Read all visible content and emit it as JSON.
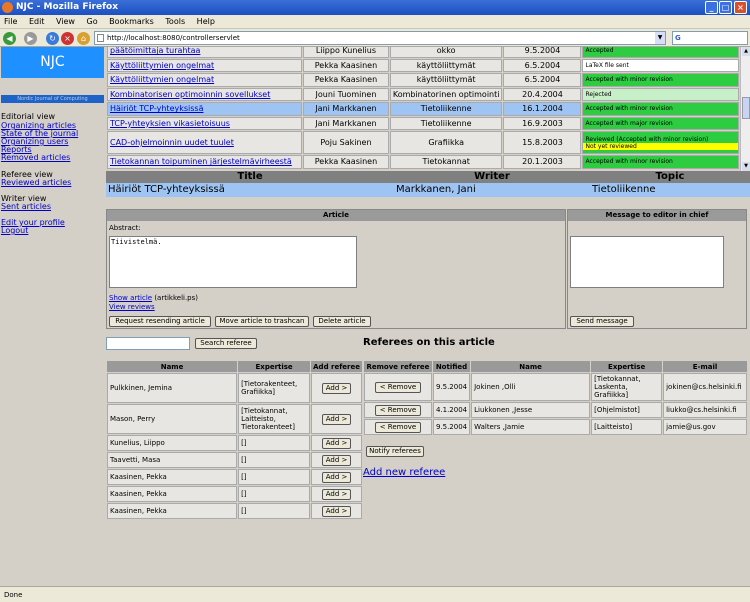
{
  "window": {
    "title": "NJC - Mozilla Firefox"
  },
  "menu": [
    "File",
    "Edit",
    "View",
    "Go",
    "Bookmarks",
    "Tools",
    "Help"
  ],
  "url": "http://localhost:8080/controllerservlet",
  "sidebar": {
    "logo": "NJC",
    "subtitle": "Nordic Journal of Computing",
    "editorial_heading": "Editorial view",
    "editorial_links": [
      "Organizing articles",
      "State of the journal",
      "Organizing users",
      "Reports",
      "Removed articles"
    ],
    "referee_heading": "Referee view",
    "referee_links": [
      "Reviewed articles"
    ],
    "writer_heading": "Writer view",
    "writer_links": [
      "Sent articles"
    ],
    "bottom_links": [
      "Edit your profile",
      "Logout"
    ]
  },
  "articles": [
    {
      "title": "päätöimittaja turahtaa",
      "writer": "Liippo Kunelius",
      "topic": "okko",
      "date": "9.5.2004",
      "status": "Accepted",
      "status_color": "green"
    },
    {
      "title": "Käyttöliittymien ongelmat",
      "writer": "Pekka Kaasinen",
      "topic": "käyttöliittymät",
      "date": "6.5.2004",
      "status": "LaTeX file sent",
      "status_color": "white"
    },
    {
      "title": "Käyttöliittymien ongelmat",
      "writer": "Pekka Kaasinen",
      "topic": "käyttöliittymät",
      "date": "6.5.2004",
      "status": "Accepted with minor revision",
      "status_color": "green"
    },
    {
      "title": "Kombinatorisen optimoinnin sovellukset",
      "writer": "Jouni Tuominen",
      "topic": "Kombinatorinen optimointi",
      "date": "20.4.2004",
      "status": "Rejected",
      "status_color": "lightgreen"
    },
    {
      "title": "Häiriöt TCP-yhteyksissä",
      "writer": "Jani Markkanen",
      "topic": "Tietoliikenne",
      "date": "16.1.2004",
      "status": "Accepted with minor revision",
      "status_color": "green"
    },
    {
      "title": "TCP-yhteyksien vikasietoisuus",
      "writer": "Jani Markkanen",
      "topic": "Tietoliikenne",
      "date": "16.9.2003",
      "status": "Accepted with major revision",
      "status_color": "green"
    },
    {
      "title": "CAD-ohjelmoinnin uudet tuulet",
      "writer": "Poju Sakinen",
      "topic": "Grafiikka",
      "date": "15.8.2003",
      "status": "Reviewed (Accepted with minor revision)",
      "status2": "Not yet reviewed",
      "status_color": "green"
    },
    {
      "title": "Tietokannan toipuminen järjestelmävirheestä",
      "writer": "Pekka Kaasinen",
      "topic": "Tietokannat",
      "date": "20.1.2003",
      "status": "Accepted with minor revision",
      "status_color": "green"
    }
  ],
  "selected": {
    "headers": {
      "title": "Title",
      "writer": "Writer",
      "topic": "Topic"
    },
    "title": "Häiriöt TCP-yhteyksissä",
    "writer": "Markkanen, Jani",
    "topic": "Tietoliikenne"
  },
  "article_panel": {
    "header": "Article",
    "abstract_label": "Abstract:",
    "abstract_text": "Tiivistelmä.",
    "show_article": "Show article",
    "file_name": "(artikkeli.ps)",
    "view_reviews": "View reviews",
    "btn_resend": "Request resending article",
    "btn_trash": "Move article to trashcan",
    "btn_delete": "Delete article"
  },
  "message_panel": {
    "header": "Message to editor in chief",
    "btn_send": "Send message"
  },
  "referees": {
    "title": "Referees on this article",
    "search_button": "Search referee",
    "available_headers": {
      "name": "Name",
      "expertise": "Expertise",
      "add": "Add referee"
    },
    "add_label": "Add >",
    "available": [
      {
        "name": "Pulkkinen, Jemina",
        "expertise": "[Tietorakenteet, Grafiikka]"
      },
      {
        "name": "Mason, Perry",
        "expertise": "[Tietokannat, Laitteisto, Tietorakenteet]"
      },
      {
        "name": "Kunelius, Liippo",
        "expertise": "[]"
      },
      {
        "name": "Taavetti, Masa",
        "expertise": "[]"
      },
      {
        "name": "Kaasinen, Pekka",
        "expertise": "[]"
      },
      {
        "name": "Kaasinen, Pekka",
        "expertise": "[]"
      },
      {
        "name": "Kaasinen, Pekka",
        "expertise": "[]"
      }
    ],
    "assigned_headers": {
      "remove": "Remove referee",
      "notified": "Notified",
      "name": "Name",
      "expertise": "Expertise",
      "email": "E-mail"
    },
    "remove_label": "< Remove",
    "assigned": [
      {
        "notified": "9.5.2004",
        "name": "Jokinen ,Olli",
        "expertise": "[Tietokannat, Laskenta, Grafiikka]",
        "email": "jokinen@cs.helsinki.fi"
      },
      {
        "notified": "4.1.2004",
        "name": "Liukkonen ,Jesse",
        "expertise": "[Ohjelmistot]",
        "email": "liukko@cs.helsinki.fi"
      },
      {
        "notified": "9.5.2004",
        "name": "Walters ,Jamie",
        "expertise": "[Laitteisto]",
        "email": "jamie@us.gov"
      }
    ],
    "notify_button": "Notify referees",
    "add_new": "Add new referee"
  },
  "statusbar": "Done",
  "colors": {
    "green": "#2ecc40",
    "selected_row": "#9ec4f4",
    "logo": "#1e90ff"
  }
}
